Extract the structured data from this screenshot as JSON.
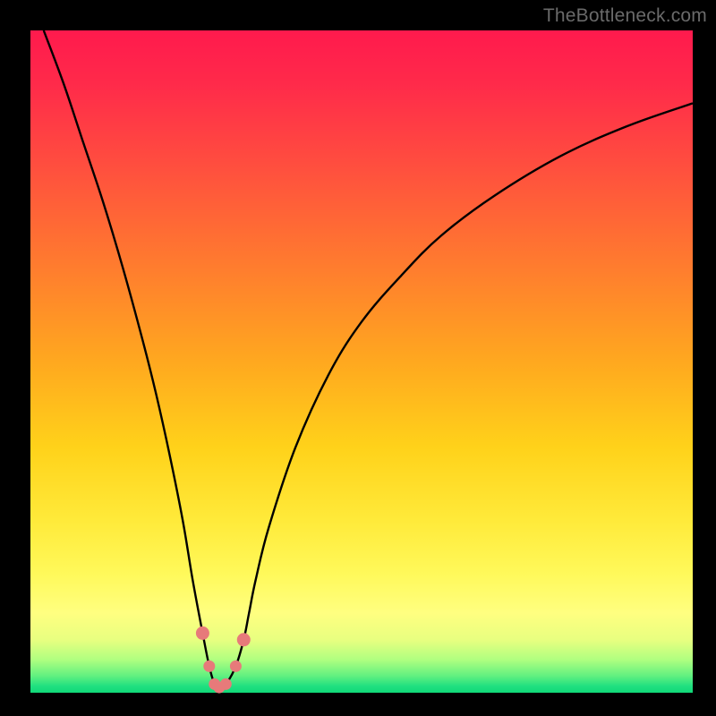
{
  "watermark": "TheBottleneck.com",
  "colors": {
    "background": "#000000",
    "curve_stroke": "#000000",
    "marker_fill": "#e77a7a",
    "marker_stroke": "#d86666",
    "watermark_text": "#6a6a6a"
  },
  "chart_data": {
    "type": "line",
    "title": "",
    "xlabel": "",
    "ylabel": "",
    "xlim": [
      0,
      100
    ],
    "ylim": [
      0,
      100
    ],
    "grid": false,
    "legend": false,
    "series": [
      {
        "name": "bottleneck-curve",
        "x": [
          2,
          5,
          8,
          11,
          14,
          17,
          19,
          21,
          23,
          24.5,
          26,
          27,
          27.8,
          28.5,
          29.5,
          31,
          32.2,
          33,
          34,
          36,
          40,
          45,
          50,
          56,
          62,
          70,
          80,
          90,
          100
        ],
        "y": [
          100,
          92,
          83,
          74,
          64,
          53,
          45,
          36,
          26,
          17,
          9,
          4,
          1.3,
          0.8,
          1.3,
          4,
          8,
          12,
          17,
          25,
          37,
          48,
          56,
          63,
          69,
          75,
          81,
          85.5,
          89
        ]
      }
    ],
    "markers": {
      "name": "highlighted-points",
      "x": [
        26.0,
        27.0,
        27.8,
        28.5,
        29.5,
        31.0,
        32.2
      ],
      "y": [
        9.0,
        4.0,
        1.3,
        0.8,
        1.3,
        4.0,
        8.0
      ]
    },
    "annotations": []
  }
}
